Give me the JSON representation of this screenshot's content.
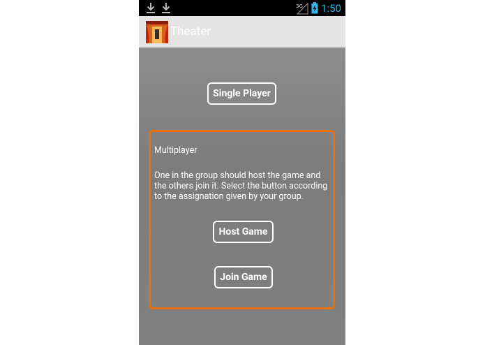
{
  "status_bar": {
    "time": "1:50",
    "network": "3G",
    "icons": [
      "download-icon",
      "download-icon",
      "signal-icon",
      "battery-charging-icon"
    ]
  },
  "action_bar": {
    "title": "Theater",
    "icon": "theater-curtain-icon"
  },
  "main": {
    "single_player_label": "Single Player",
    "multiplayer": {
      "title": "Multiplayer",
      "description": "One in the group should host the game and the others join it. Select the button according to the assignation given by your group.",
      "host_label": "Host Game",
      "join_label": "Join Game"
    }
  },
  "colors": {
    "accent_border": "#e8710b",
    "time_text": "#33b5e5",
    "background": "#808080"
  }
}
